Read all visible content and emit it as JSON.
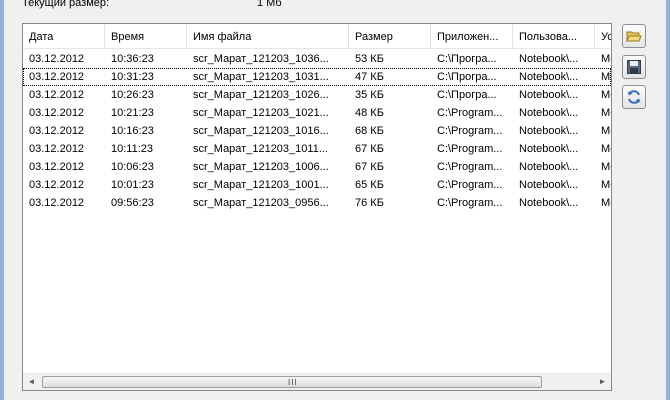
{
  "current_size": {
    "label": "Текущий размер:",
    "value": "1 Мб"
  },
  "columns": [
    "Дата",
    "Время",
    "Имя файла",
    "Размер",
    "Приложен...",
    "Пользова...",
    "Ус"
  ],
  "rows": [
    [
      "03.12.2012",
      "10:36:23",
      "scr_Марат_121203_1036...",
      "53 КБ",
      "C:\\Програ...",
      "Notebook\\...",
      "Ме"
    ],
    [
      "03.12.2012",
      "10:31:23",
      "scr_Марат_121203_1031...",
      "47 КБ",
      "C:\\Програ...",
      "Notebook\\...",
      "Ме"
    ],
    [
      "03.12.2012",
      "10:26:23",
      "scr_Марат_121203_1026...",
      "35 КБ",
      "C:\\Програ...",
      "Notebook\\...",
      "Ме"
    ],
    [
      "03.12.2012",
      "10:21:23",
      "scr_Марат_121203_1021...",
      "48 КБ",
      "C:\\Program...",
      "Notebook\\...",
      "Ме"
    ],
    [
      "03.12.2012",
      "10:16:23",
      "scr_Марат_121203_1016...",
      "68 КБ",
      "C:\\Program...",
      "Notebook\\...",
      "Ме"
    ],
    [
      "03.12.2012",
      "10:11:23",
      "scr_Марат_121203_1011...",
      "67 КБ",
      "C:\\Program...",
      "Notebook\\...",
      "Ме"
    ],
    [
      "03.12.2012",
      "10:06:23",
      "scr_Марат_121203_1006...",
      "67 КБ",
      "C:\\Program...",
      "Notebook\\...",
      "Ме"
    ],
    [
      "03.12.2012",
      "10:01:23",
      "scr_Марат_121203_1001...",
      "65 КБ",
      "C:\\Program...",
      "Notebook\\...",
      "Ме"
    ],
    [
      "03.12.2012",
      "09:56:23",
      "scr_Марат_121203_0956...",
      "76 КБ",
      "C:\\Program...",
      "Notebook\\...",
      "Ме"
    ]
  ],
  "scrollbar": {
    "left_arrow": "◄",
    "right_arrow": "►",
    "grip": "III"
  },
  "toolbar": [
    {
      "icon": "open-folder-icon"
    },
    {
      "icon": "save-disk-icon"
    },
    {
      "icon": "refresh-icon"
    }
  ],
  "colors": {
    "window_border": "#8fb3d9",
    "list_border": "#828790",
    "icon_blue": "#2f6fbd",
    "folder_yellow": "#e8c25a"
  }
}
